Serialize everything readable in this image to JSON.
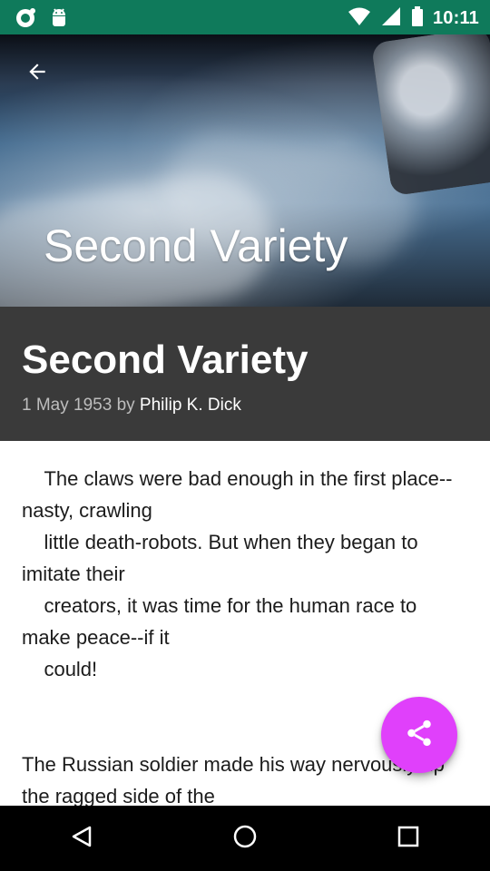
{
  "status_bar": {
    "time": "10:11",
    "left_icons": [
      "sync-icon",
      "android-debug-icon"
    ],
    "right_icons": [
      "wifi-icon",
      "signal-icon",
      "battery-icon"
    ]
  },
  "hero": {
    "title": "Second Variety",
    "back_icon": "arrow-left-icon"
  },
  "article_header": {
    "title": "Second Variety",
    "date_prefix": "1 May 1953 by",
    "author": "Philip K. Dick"
  },
  "article_body": {
    "text": "    The claws were bad enough in the first place--nasty, crawling\n    little death-robots. But when they began to imitate their\n    creators, it was time for the human race to make peace--if it\n    could!\n\n\nThe Russian soldier made his way nervously up the ragged side of the"
  },
  "fab": {
    "icon": "share-icon",
    "color": "#E040FB"
  },
  "nav_bar": {
    "buttons": [
      "back-icon",
      "home-icon",
      "recents-icon"
    ]
  },
  "colors": {
    "status_bar": "#0F7A5B",
    "header_dark": "#3A3A3A"
  }
}
